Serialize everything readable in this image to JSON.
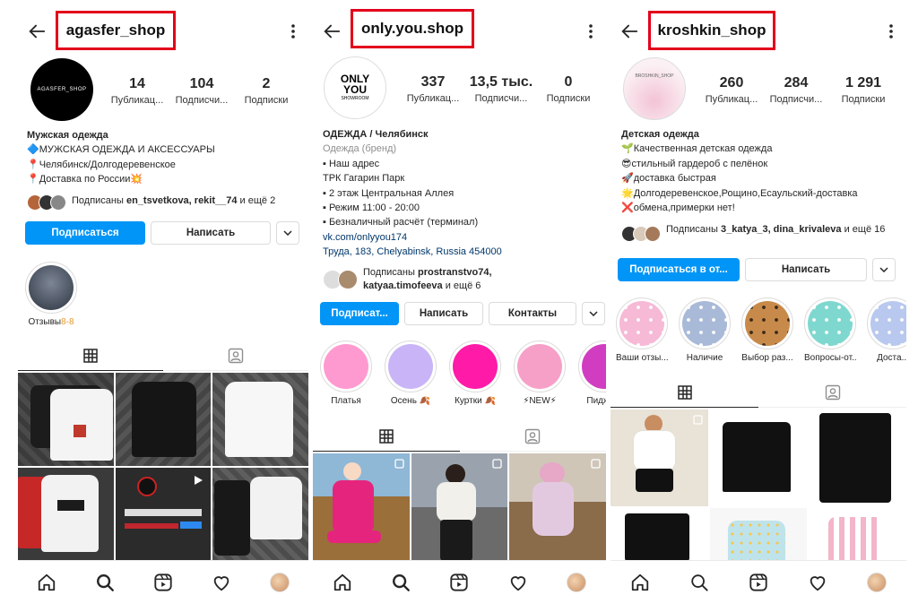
{
  "screens": [
    {
      "username": "agasfer_shop",
      "avatar_text": "AGASFER_SHOP",
      "stats": [
        {
          "num": "14",
          "label": "Публикац..."
        },
        {
          "num": "104",
          "label": "Подписчи..."
        },
        {
          "num": "2",
          "label": "Подписки"
        }
      ],
      "bio": [
        "Мужская одежда",
        "🔷МУЖСКАЯ ОДЕЖДА И АКСЕССУАРЫ",
        "📍Челябинск/Долгодеревенское",
        "📍Доставка по России💥"
      ],
      "followed_prefix": "Подписаны ",
      "followed_names": "en_tsvetkova, rekit__74",
      "followed_suffix": " и ещё 2",
      "buttons": {
        "follow": "Подписаться",
        "message": "Написать"
      },
      "highlights": [
        {
          "label": "Отзывы",
          "label_suffix": "8-8",
          "color": "#2c3440"
        }
      ],
      "grid_colors": [
        "#3a3a3a",
        "#4a4a4a",
        "#555",
        "#6b2a2a",
        "#4a4a4a",
        "#2f2f2f"
      ]
    },
    {
      "username": "only.you.shop",
      "avatar_text": [
        "ONLY",
        "YOU",
        "SHOWROOM"
      ],
      "stats": [
        {
          "num": "337",
          "label": "Публикац..."
        },
        {
          "num": "13,5 тыс.",
          "label": "Подписчи..."
        },
        {
          "num": "0",
          "label": "Подписки"
        }
      ],
      "bio": [
        "ОДЕЖДА / Челябинск",
        "Одежда (бренд)",
        "▪ Наш адрес",
        "ТРК Гагарин Парк",
        "▪ 2 этаж Центральная Аллея",
        "▪ Режим 11:00 - 20:00",
        "▪ Безналичный расчёт (терминал)",
        "vk.com/onlyyou174",
        "Труда, 183, Chelyabinsk, Russia 454000"
      ],
      "followed_prefix": "Подписаны ",
      "followed_names_1": "prostranstvo74,",
      "followed_names_2": "katyaa.timofeeva",
      "followed_suffix": " и ещё 6",
      "buttons": {
        "follow": "Подписат...",
        "message": "Написать",
        "contacts": "Контакты"
      },
      "highlights": [
        {
          "label": "Платья",
          "color": "#ff9ad0"
        },
        {
          "label": "Осень 🍂",
          "color": "#c9b4f7"
        },
        {
          "label": "Куртки 🍂",
          "color": "#ff1aa8"
        },
        {
          "label": "⚡NEW⚡",
          "color": "#f6a0c8"
        },
        {
          "label": "Пиджа...",
          "color": "#d13dc0"
        }
      ],
      "grid_colors": [
        "#c23d7a",
        "#6b6b6b",
        "#9a8a76"
      ]
    },
    {
      "username": "kroshkin_shop",
      "avatar_text": "BROSHKIN_SHOP",
      "stats": [
        {
          "num": "260",
          "label": "Публикац..."
        },
        {
          "num": "284",
          "label": "Подписчи..."
        },
        {
          "num": "1 291",
          "label": "Подписки"
        }
      ],
      "bio": [
        "Детская одежда",
        "🌱Качественная детская одежда",
        "😎стильный гардероб с пелёнок",
        "🚀доставка быстрая",
        "🌟Долгодеревенское,Рощино,Есаульский-доставка",
        "❌обмена,примерки нет!"
      ],
      "followed_prefix": "Подписаны ",
      "followed_names": "3_katya_3, dina_krivaleva",
      "followed_suffix": " и ещё 16",
      "buttons": {
        "follow": "Подписаться в от...",
        "message": "Написать"
      },
      "highlights": [
        {
          "label": "Ваши отзы...",
          "color": "#f6b9d6"
        },
        {
          "label": "Наличие",
          "color": "#a9b9d8"
        },
        {
          "label": "Выбор раз...",
          "color": "#c88a4a"
        },
        {
          "label": "Вопросы-от...",
          "color": "#7fd8cf"
        },
        {
          "label": "Доста...",
          "color": "#b8c8ee"
        }
      ],
      "grid_colors": [
        "#e9e2d6",
        "#ffffff",
        "#ffffff",
        "#ffffff",
        "#bfe3ea",
        "#f3b5c8"
      ]
    }
  ],
  "colors": {
    "accent": "#0095f6",
    "highlight_border": "#e3001b",
    "link": "#00376b"
  }
}
